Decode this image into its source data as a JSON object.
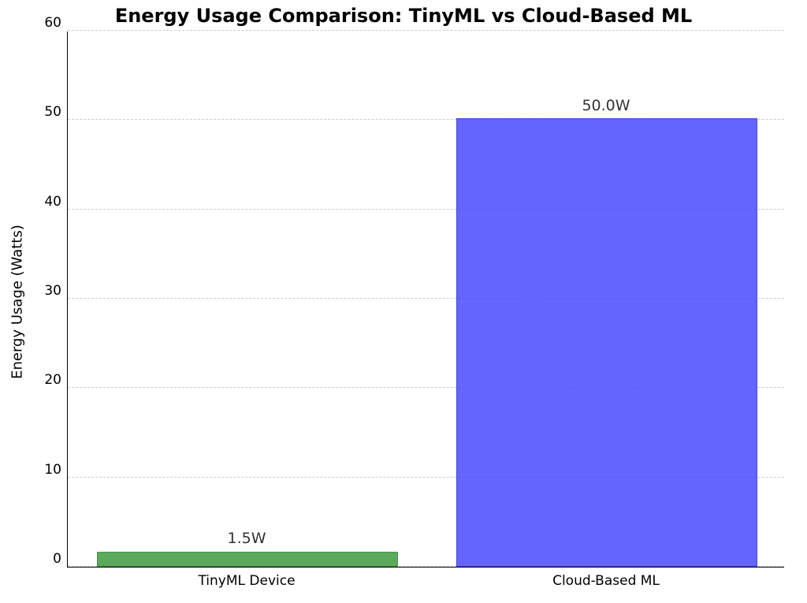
{
  "chart_data": {
    "type": "bar",
    "title": "Energy Usage Comparison: TinyML vs Cloud-Based ML",
    "xlabel": "",
    "ylabel": "Energy Usage (Watts)",
    "ylim": [
      0,
      60
    ],
    "yticks": [
      0,
      10,
      20,
      30,
      40,
      50,
      60
    ],
    "categories": [
      "TinyML Device",
      "Cloud-Based ML"
    ],
    "values": [
      1.5,
      50.0
    ],
    "value_labels": [
      "1.5W",
      "50.0W"
    ],
    "colors": [
      "#3f9b3f",
      "#4b4bff"
    ]
  },
  "yticklabels": {
    "0": "0",
    "1": "10",
    "2": "20",
    "3": "30",
    "4": "40",
    "5": "50",
    "6": "60"
  }
}
